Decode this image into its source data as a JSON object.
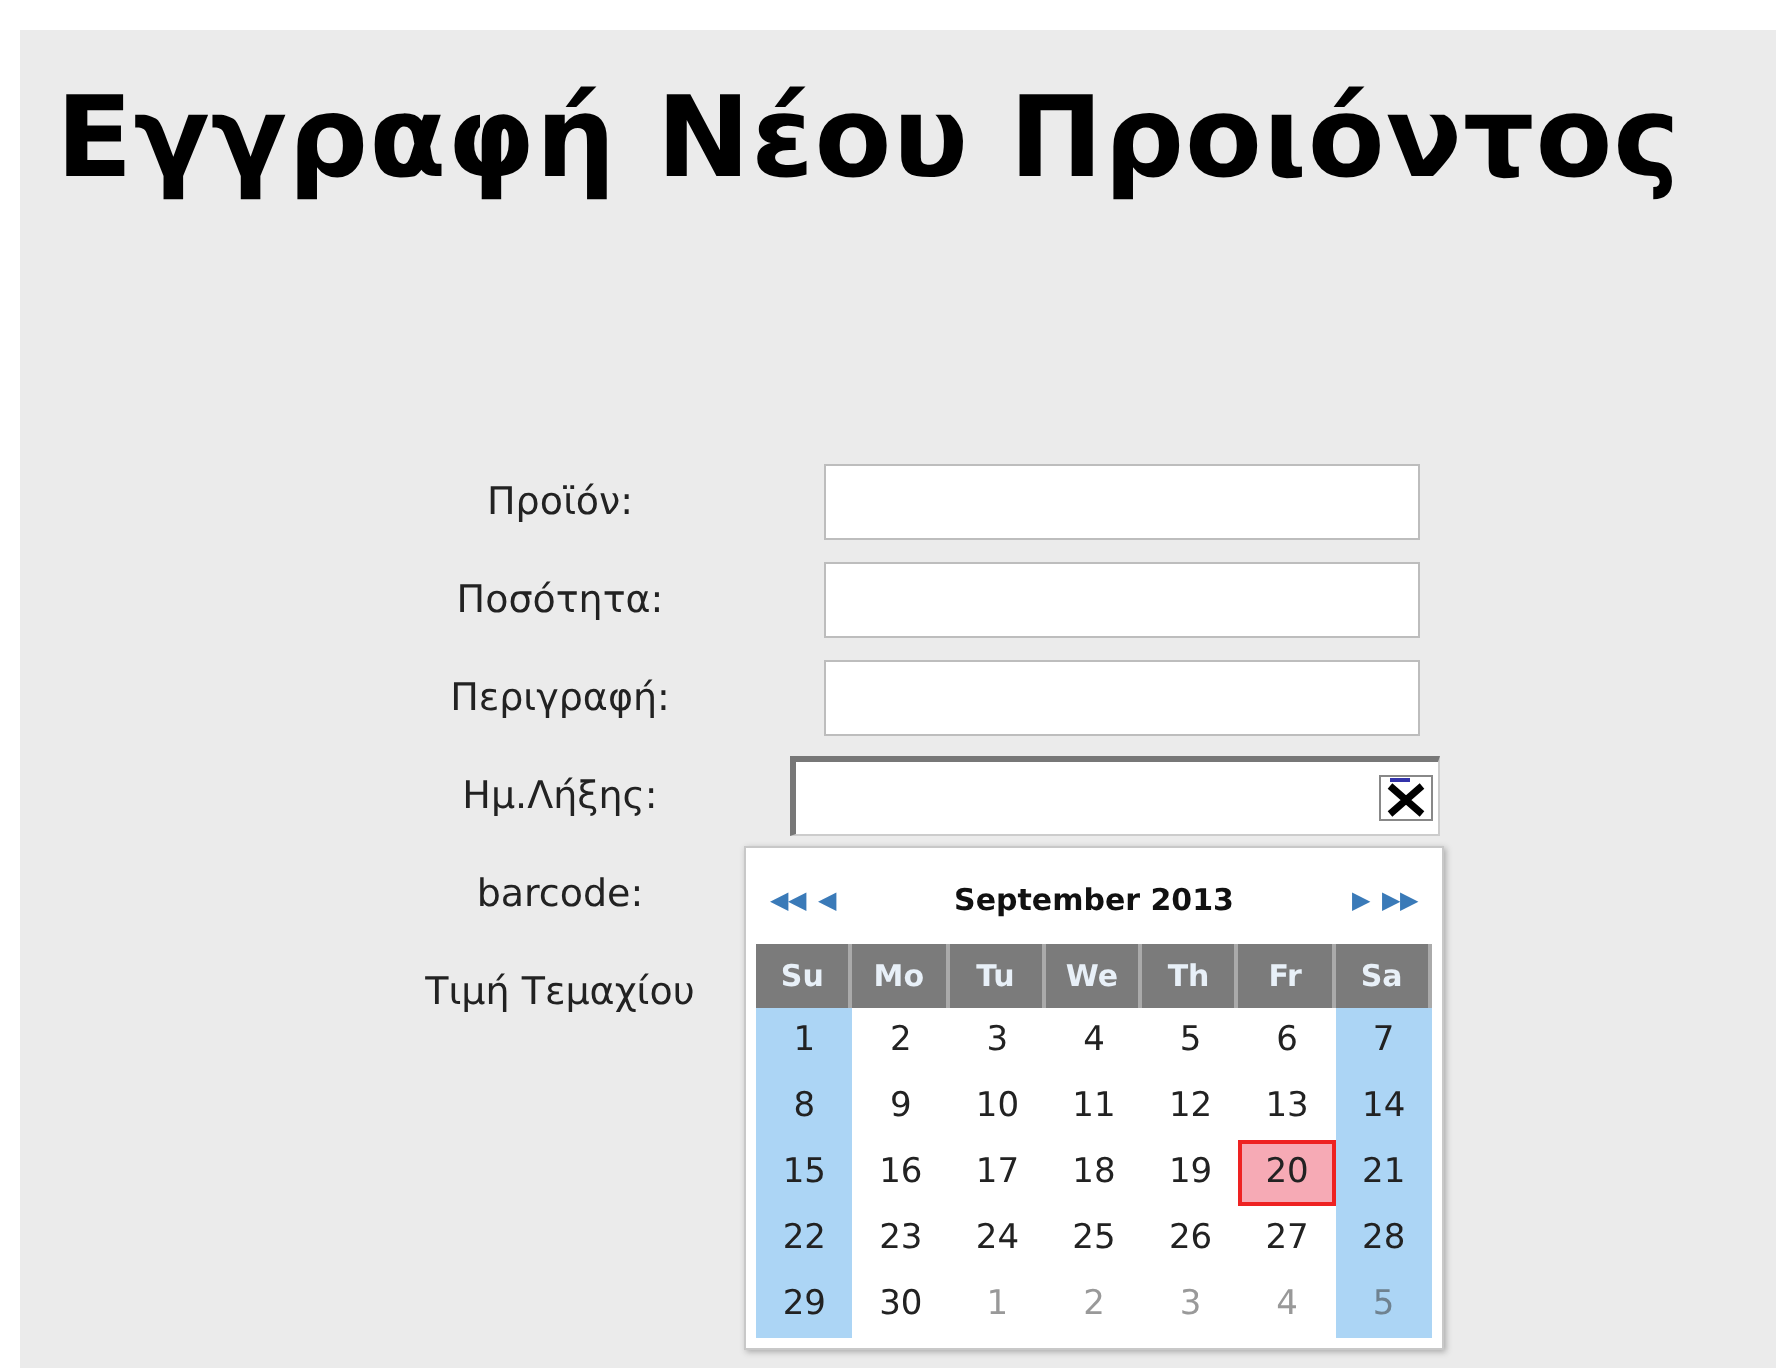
{
  "title": "Εγγραφή Νέου Προιόντος",
  "fields": [
    {
      "label": "Προϊόν:",
      "kind": "text"
    },
    {
      "label": "Ποσότητα:",
      "kind": "text"
    },
    {
      "label": "Περιγραφή:",
      "kind": "text"
    },
    {
      "label": "Ημ.Λήξης:",
      "kind": "date"
    },
    {
      "label": "barcode:",
      "kind": "hidden"
    },
    {
      "label": "Τιμή Τεμαχίου",
      "kind": "hidden"
    }
  ],
  "calendar": {
    "prev_year": "◀◀",
    "prev_month": "◀",
    "month": "September 2013",
    "next_month": "▶",
    "next_year": "▶▶",
    "weekdays": [
      "Su",
      "Mo",
      "Tu",
      "We",
      "Th",
      "Fr",
      "Sa"
    ],
    "weeks": [
      [
        {
          "day": "1",
          "other_month": false,
          "selected": false
        },
        {
          "day": "2",
          "other_month": false,
          "selected": false
        },
        {
          "day": "3",
          "other_month": false,
          "selected": false
        },
        {
          "day": "4",
          "other_month": false,
          "selected": false
        },
        {
          "day": "5",
          "other_month": false,
          "selected": false
        },
        {
          "day": "6",
          "other_month": false,
          "selected": false
        },
        {
          "day": "7",
          "other_month": false,
          "selected": false
        }
      ],
      [
        {
          "day": "8",
          "other_month": false,
          "selected": false
        },
        {
          "day": "9",
          "other_month": false,
          "selected": false
        },
        {
          "day": "10",
          "other_month": false,
          "selected": false
        },
        {
          "day": "11",
          "other_month": false,
          "selected": false
        },
        {
          "day": "12",
          "other_month": false,
          "selected": false
        },
        {
          "day": "13",
          "other_month": false,
          "selected": false
        },
        {
          "day": "14",
          "other_month": false,
          "selected": false
        }
      ],
      [
        {
          "day": "15",
          "other_month": false,
          "selected": false
        },
        {
          "day": "16",
          "other_month": false,
          "selected": false
        },
        {
          "day": "17",
          "other_month": false,
          "selected": false
        },
        {
          "day": "18",
          "other_month": false,
          "selected": false
        },
        {
          "day": "19",
          "other_month": false,
          "selected": false
        },
        {
          "day": "20",
          "other_month": false,
          "selected": true
        },
        {
          "day": "21",
          "other_month": false,
          "selected": false
        }
      ],
      [
        {
          "day": "22",
          "other_month": false,
          "selected": false
        },
        {
          "day": "23",
          "other_month": false,
          "selected": false
        },
        {
          "day": "24",
          "other_month": false,
          "selected": false
        },
        {
          "day": "25",
          "other_month": false,
          "selected": false
        },
        {
          "day": "26",
          "other_month": false,
          "selected": false
        },
        {
          "day": "27",
          "other_month": false,
          "selected": false
        },
        {
          "day": "28",
          "other_month": false,
          "selected": false
        }
      ],
      [
        {
          "day": "29",
          "other_month": false,
          "selected": false
        },
        {
          "day": "30",
          "other_month": false,
          "selected": false
        },
        {
          "day": "1",
          "other_month": true,
          "selected": false
        },
        {
          "day": "2",
          "other_month": true,
          "selected": false
        },
        {
          "day": "3",
          "other_month": true,
          "selected": false
        },
        {
          "day": "4",
          "other_month": true,
          "selected": false
        },
        {
          "day": "5",
          "other_month": true,
          "selected": false
        }
      ]
    ]
  }
}
